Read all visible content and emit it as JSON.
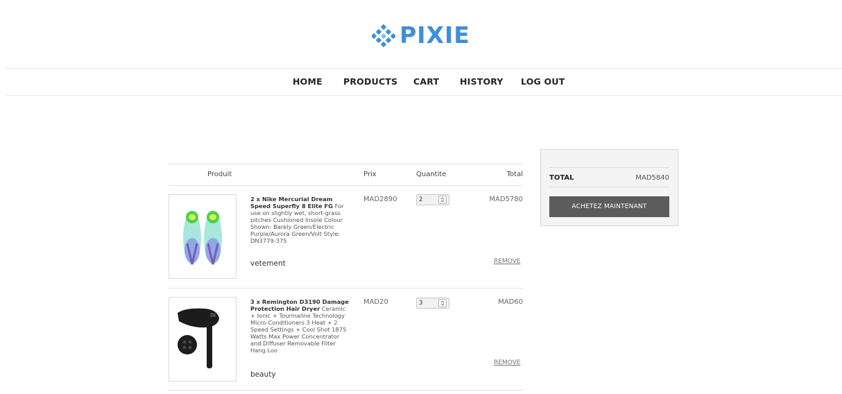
{
  "brand": {
    "name": "PIXIE",
    "color": "#3e8fd9"
  },
  "nav": {
    "items": [
      "HOME",
      "PRODUCTS",
      "CART",
      "HISTORY",
      "LOG OUT"
    ]
  },
  "cart": {
    "headers": {
      "product": "Produit",
      "price": "Prix",
      "quantity": "Quantite",
      "total": "Total"
    },
    "items": [
      {
        "title": "2 x Nike Mercurial Dream Speed Superfly 8 Elite FG",
        "description": "For use on slightly wet, short-grass pitches Cushioned Insole Colour Shown: Barely Green/Electric Purple/Aurora Green/Volt Style: DN3779-375",
        "category": "vetement",
        "price": "MAD2890",
        "quantity": "2",
        "total": "MAD5780",
        "remove": "REMOVE",
        "image_icon": "soccer-cleats-image"
      },
      {
        "title": "3 x Remington D3190 Damage Protection Hair Dryer",
        "description": "Ceramic + Ionic + Tourmaline Technology Micro-Conditioners 3 Heat + 2 Speed Settings + Cool Shot 1875 Watts Max Power Concentrator and Diffuser Removable Filter Hang Loo",
        "category": "beauty",
        "price": "MAD20",
        "quantity": "3",
        "total": "MAD60",
        "remove": "REMOVE",
        "image_icon": "hair-dryer-image"
      }
    ]
  },
  "summary": {
    "label": "TOTAL",
    "value": "MAD5840",
    "button": "ACHETEZ MAINTENANT",
    "button_color": "#5c5c5c"
  }
}
